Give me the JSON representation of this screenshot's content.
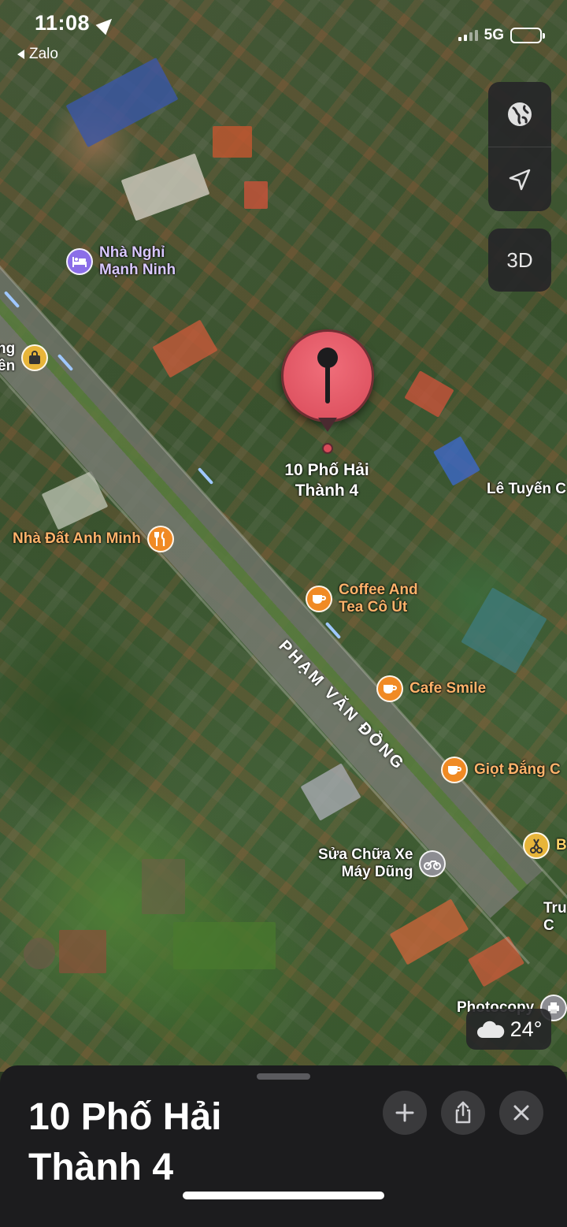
{
  "status_bar": {
    "time": "11:08",
    "back_app": "Zalo",
    "network": "5G"
  },
  "map_controls": {
    "globe_icon": "globe-icon",
    "location_icon": "location-arrow-icon",
    "view_3d_label": "3D"
  },
  "pin": {
    "label_line1": "10 Phố Hải",
    "label_line2": "Thành 4",
    "color": "#d94a59"
  },
  "street_label": "PHẠM VĂN ĐỒNG",
  "pois": [
    {
      "line1": "Nhà Nghỉ",
      "line2": "Mạnh Ninh",
      "icon": "bed-icon",
      "category": "lodging"
    },
    {
      "line1": "ng",
      "line2": "ền",
      "icon": "shopping-bag-icon",
      "category": "shop"
    },
    {
      "line1": "Nhà Đất Anh Minh",
      "line2": "",
      "icon": "fork-knife-icon",
      "category": "restaurant"
    },
    {
      "line1": "Coffee And",
      "line2": "Tea Cô Út",
      "icon": "coffee-cup-icon",
      "category": "cafe"
    },
    {
      "line1": "Cafe Smile",
      "line2": "",
      "icon": "coffee-cup-icon",
      "category": "cafe"
    },
    {
      "line1": "Giọt Đắng C",
      "line2": "",
      "icon": "coffee-cup-icon",
      "category": "cafe"
    },
    {
      "line1": "Sửa Chữa Xe",
      "line2": "Máy Dũng",
      "icon": "motorbike-icon",
      "category": "service"
    },
    {
      "line1": "B",
      "line2": "",
      "icon": "scissors-icon",
      "category": "service"
    },
    {
      "line1": "Lê Tuyến C",
      "line2": "",
      "icon": "",
      "category": "place"
    },
    {
      "line1": "Tru",
      "line2": "C",
      "icon": "",
      "category": "place"
    },
    {
      "line1": "Photocopy",
      "line2": "",
      "icon": "printer-icon",
      "category": "service"
    }
  ],
  "weather": {
    "icon": "cloud-icon",
    "temperature": "24°"
  },
  "sheet": {
    "title_line1": "10 Phố Hải",
    "title_line2": "Thành 4",
    "add_icon": "plus-icon",
    "share_icon": "share-icon",
    "close_icon": "close-icon"
  },
  "colors": {
    "poi_orange": "#f08a24",
    "poi_purple": "#8b6ee8",
    "poi_gold": "#e7b53a",
    "sheet_bg": "#1c1c1e"
  }
}
